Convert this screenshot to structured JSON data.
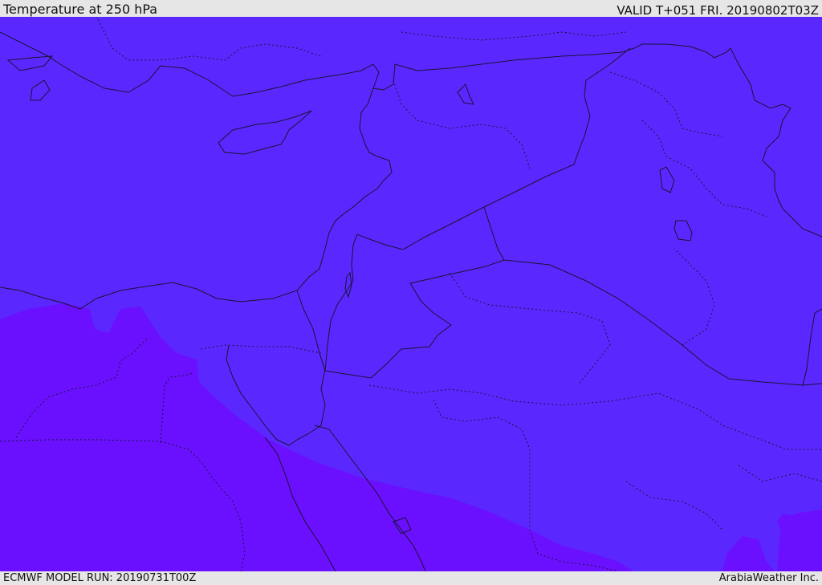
{
  "header": {
    "title": "Temperature at 250 hPa",
    "valid": "VALID T+051 FRI. 20190802T03Z"
  },
  "footer": {
    "model_run": "ECMWF MODEL RUN: 20190731T00Z",
    "brand": "ArabiaWeather Inc."
  },
  "map": {
    "colors": {
      "warm_band": "#5a28ff",
      "hot_band": "#6a10ff",
      "outline": "#1a1233"
    }
  }
}
